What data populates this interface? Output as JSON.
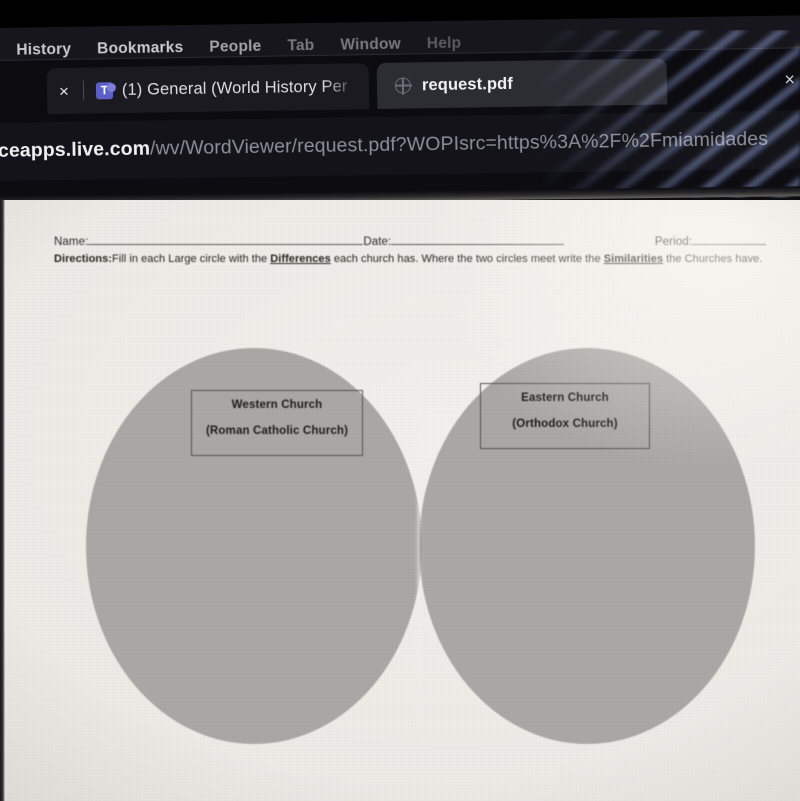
{
  "browser": {
    "menubar": {
      "items": [
        {
          "label": "History"
        },
        {
          "label": "Bookmarks"
        },
        {
          "label": "People"
        },
        {
          "label": "Tab"
        },
        {
          "label": "Window"
        },
        {
          "label": "Help"
        }
      ]
    },
    "tabs": [
      {
        "title": "(1) General (World History Per",
        "favicon": "microsoft-teams-icon",
        "close_label": "×",
        "active": false
      },
      {
        "title": "request.pdf",
        "favicon": "globe-icon",
        "close_label": "×",
        "active": true
      }
    ],
    "window_close_label": "×",
    "address_bar": {
      "host": "ceapps.live.com",
      "path": "/wv/WordViewer/request.pdf?WOPIsrc=https%3A%2F%2Fmiamidades"
    }
  },
  "document": {
    "header": {
      "name_label": "Name:",
      "date_label": "Date:",
      "period_label": "Period:",
      "directions_label": "Directions:",
      "directions_part1": "Fill in each Large circle with the ",
      "directions_emphasis1": "Differences",
      "directions_part2": " each church has. Where the two circles meet write the ",
      "directions_emphasis2": "Similarities",
      "directions_part3": " the Churches have."
    },
    "venn": {
      "left_circle": {
        "title": "Western Church",
        "subtitle": "(Roman Catholic Church)"
      },
      "right_circle": {
        "title": "Eastern Church",
        "subtitle": "(Orthodox Church)"
      }
    }
  },
  "colors": {
    "circle_fill": "#aaa8a4",
    "overlap_fill": "#858380",
    "paper": "#eceae5",
    "chrome": "#0c0c11",
    "teams_purple": "#5b5fc7"
  }
}
